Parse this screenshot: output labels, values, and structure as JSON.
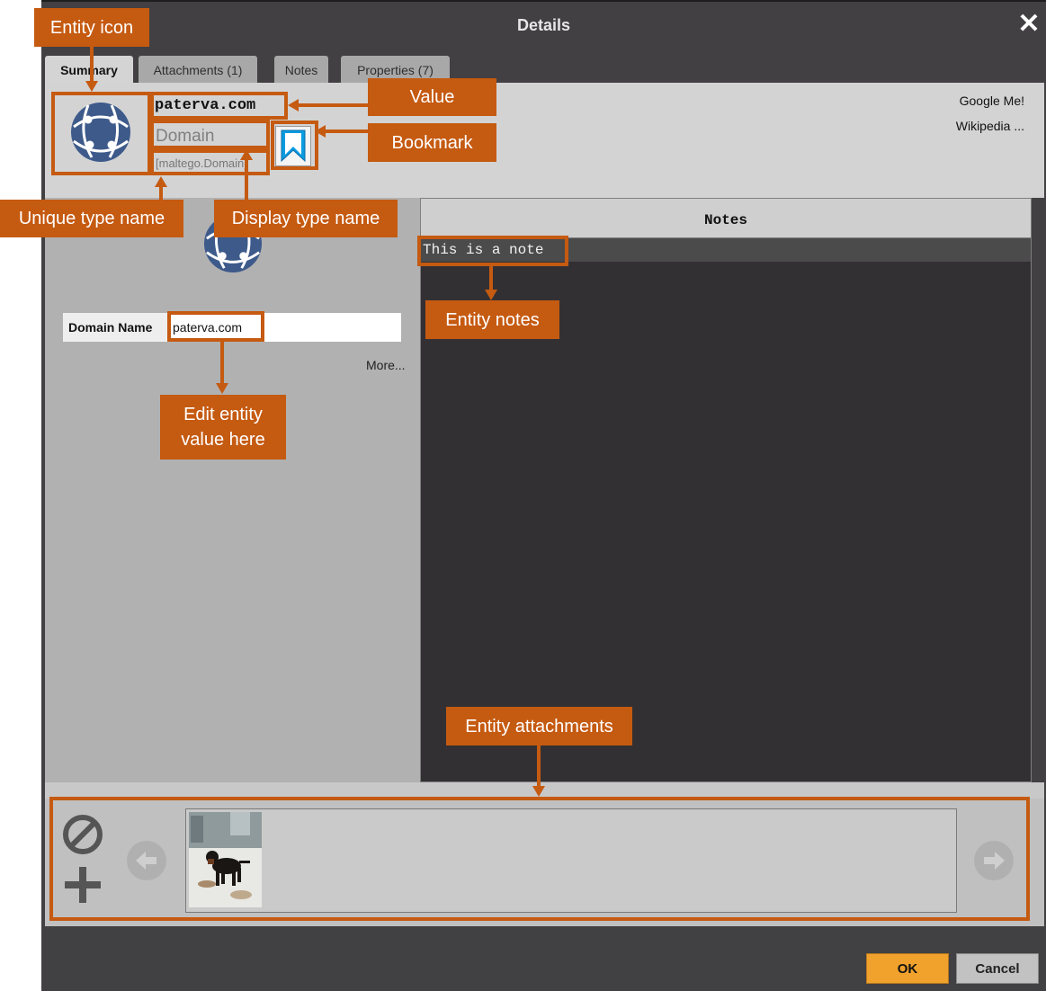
{
  "window": {
    "title": "Details",
    "close_glyph": "✕"
  },
  "tabs": [
    {
      "label": "Summary",
      "active": true
    },
    {
      "label": "Attachments (1)",
      "active": false
    },
    {
      "label": "Notes",
      "active": false
    },
    {
      "label": "Properties (7)",
      "active": false
    }
  ],
  "entity": {
    "icon": "globe-network-icon",
    "value": "paterva.com",
    "display_type": "Domain",
    "unique_type": "[maltego.Domain]",
    "bookmark_icon": "bookmark-icon",
    "bookmark_color": "#0a9be0"
  },
  "links": {
    "google": "Google Me!",
    "wikipedia": "Wikipedia ..."
  },
  "property": {
    "label": "Domain Name",
    "value": "paterva.com",
    "more": "More..."
  },
  "notes": {
    "header": "Notes",
    "text": "This is a note"
  },
  "attachments": {
    "remove_icon": "no-entry-icon",
    "add_icon": "plus-icon",
    "prev_icon": "arrow-left-icon",
    "next_icon": "arrow-right-icon",
    "thumbnail": "dog-photo-thumbnail"
  },
  "buttons": {
    "ok": "OK",
    "cancel": "Cancel"
  },
  "annotations": {
    "entity_icon": "Entity icon",
    "value": "Value",
    "bookmark": "Bookmark",
    "unique_type_name": "Unique type name",
    "display_type_name": "Display type name",
    "entity_notes": "Entity notes",
    "edit_value": "Edit entity value here",
    "entity_attachments": "Entity attachments"
  },
  "colors": {
    "accent": "#c55a11",
    "ok_button": "#f0a22d",
    "dialog_bg": "#424042",
    "notes_bg": "#333033"
  }
}
